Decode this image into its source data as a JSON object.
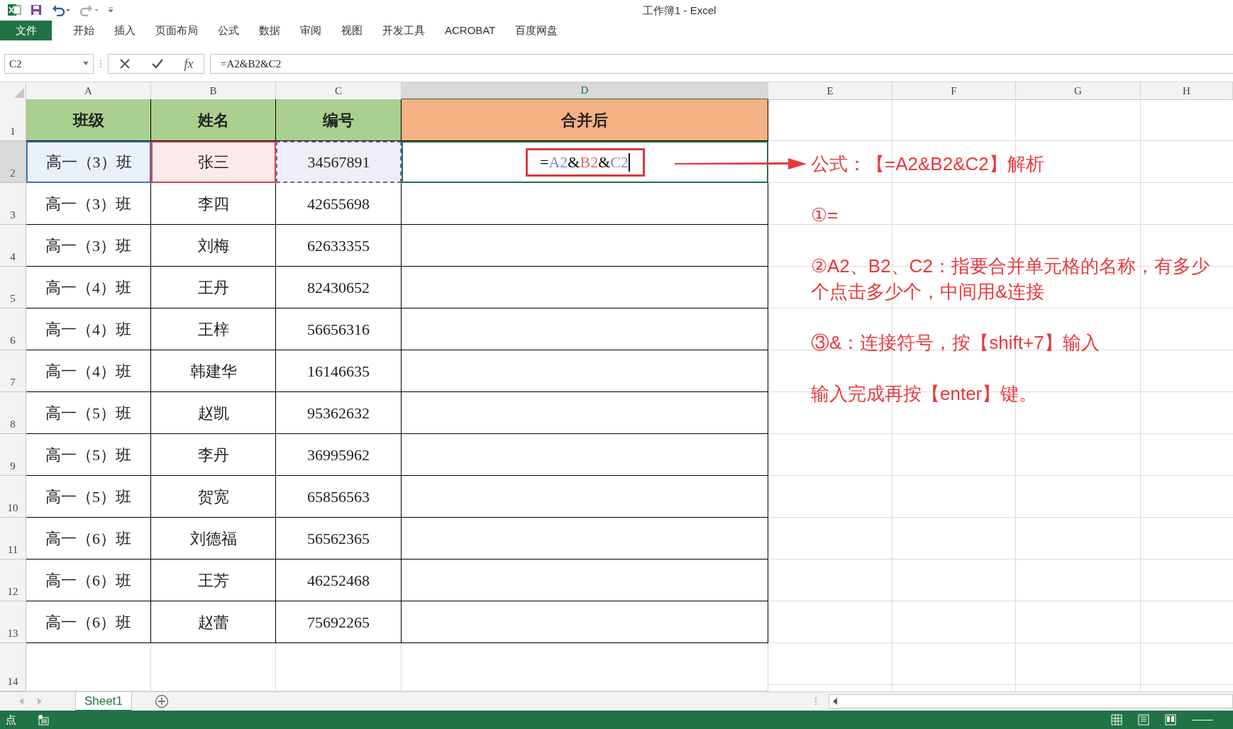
{
  "title": "工作簿1 - Excel",
  "ribbon_tabs": [
    {
      "label": "文件",
      "kind": "file"
    },
    {
      "label": "开始",
      "kind": "tab"
    },
    {
      "label": "插入",
      "kind": "tab"
    },
    {
      "label": "页面布局",
      "kind": "tab"
    },
    {
      "label": "公式",
      "kind": "tab"
    },
    {
      "label": "数据",
      "kind": "tab"
    },
    {
      "label": "审阅",
      "kind": "tab"
    },
    {
      "label": "视图",
      "kind": "tab"
    },
    {
      "label": "开发工具",
      "kind": "tab"
    },
    {
      "label": "ACROBAT",
      "kind": "tab"
    },
    {
      "label": "百度网盘",
      "kind": "tab"
    }
  ],
  "name_box": "C2",
  "function_label": "fx",
  "formula_bar": {
    "value": "=A2&B2&C2"
  },
  "columns": [
    {
      "label": "A",
      "selected": false
    },
    {
      "label": "B",
      "selected": false
    },
    {
      "label": "C",
      "selected": false
    },
    {
      "label": "D",
      "selected": true
    },
    {
      "label": "E",
      "selected": false
    },
    {
      "label": "F",
      "selected": false
    },
    {
      "label": "G",
      "selected": false
    },
    {
      "label": "H",
      "selected": false
    }
  ],
  "rows": [
    {
      "number": "1",
      "selected": false,
      "kind": "header",
      "cells": [
        {
          "text": "班级",
          "color": "#a9d08e"
        },
        {
          "text": "姓名",
          "color": "#a9d08e"
        },
        {
          "text": "编号",
          "color": "#a9d08e"
        },
        {
          "text": "合并后",
          "color": "#f4b183"
        }
      ]
    },
    {
      "number": "2",
      "selected": true,
      "kind": "data",
      "cells": [
        {
          "text": "高一（3）班",
          "kind": "reference",
          "color": "#4472c4"
        },
        {
          "text": "张三",
          "kind": "reference",
          "color": "#e0404a"
        },
        {
          "text": "34567891",
          "kind": "reference",
          "color": "#7060b0"
        },
        {
          "kind": "editing",
          "parts": [
            {
              "text": "=",
              "color": "#000000"
            },
            {
              "text": "A2",
              "color": "#6d8fd0"
            },
            {
              "text": "&",
              "color": "#000000"
            },
            {
              "text": "B2",
              "color": "#e06a6a"
            },
            {
              "text": "&",
              "color": "#000000"
            },
            {
              "text": "C2",
              "color": "#8a80c0"
            }
          ]
        }
      ]
    },
    {
      "number": "3",
      "selected": false,
      "kind": "data",
      "cells": [
        {
          "text": "高一（3）班"
        },
        {
          "text": "李四"
        },
        {
          "text": "42655698"
        }
      ]
    },
    {
      "number": "4",
      "selected": false,
      "kind": "data",
      "cells": [
        {
          "text": "高一（3）班"
        },
        {
          "text": "刘梅"
        },
        {
          "text": "62633355"
        }
      ]
    },
    {
      "number": "5",
      "selected": false,
      "kind": "data",
      "cells": [
        {
          "text": "高一（4）班"
        },
        {
          "text": "王丹"
        },
        {
          "text": "82430652"
        }
      ]
    },
    {
      "number": "6",
      "selected": false,
      "kind": "data",
      "cells": [
        {
          "text": "高一（4）班"
        },
        {
          "text": "王梓"
        },
        {
          "text": "56656316"
        }
      ]
    },
    {
      "number": "7",
      "selected": false,
      "kind": "data",
      "cells": [
        {
          "text": "高一（4）班"
        },
        {
          "text": "韩建华"
        },
        {
          "text": "16146635"
        }
      ]
    },
    {
      "number": "8",
      "selected": false,
      "kind": "data",
      "cells": [
        {
          "text": "高一（5）班"
        },
        {
          "text": "赵凯"
        },
        {
          "text": "95362632"
        }
      ]
    },
    {
      "number": "9",
      "selected": false,
      "kind": "data",
      "cells": [
        {
          "text": "高一（5）班"
        },
        {
          "text": "李丹"
        },
        {
          "text": "36995962"
        }
      ]
    },
    {
      "number": "10",
      "selected": false,
      "kind": "data",
      "cells": [
        {
          "text": "高一（5）班"
        },
        {
          "text": "贺宽"
        },
        {
          "text": "65856563"
        }
      ]
    },
    {
      "number": "11",
      "selected": false,
      "kind": "data",
      "cells": [
        {
          "text": "高一（6）班"
        },
        {
          "text": "刘德福"
        },
        {
          "text": "56562365"
        }
      ]
    },
    {
      "number": "12",
      "selected": false,
      "kind": "data",
      "cells": [
        {
          "text": "高一（6）班"
        },
        {
          "text": "王芳"
        },
        {
          "text": "46252468"
        }
      ]
    },
    {
      "number": "13",
      "selected": false,
      "kind": "data",
      "cells": [
        {
          "text": "高一（6）班"
        },
        {
          "text": "赵蕾"
        },
        {
          "text": "75692265"
        }
      ]
    },
    {
      "number": "14",
      "selected": false,
      "kind": "empty",
      "cells": []
    }
  ],
  "annotations": [
    "公式：【=A2&B2&C2】解析",
    "①=",
    "②A2、B2、C2：指要合并单元格的名称，有多少个点击多少个，中间用&连接",
    "③&：连接符号，按【shift+7】输入",
    "输入完成再按【enter】键。"
  ],
  "sheet_tabs": [
    {
      "label": "Sheet1",
      "selected": true
    }
  ],
  "status": "点"
}
